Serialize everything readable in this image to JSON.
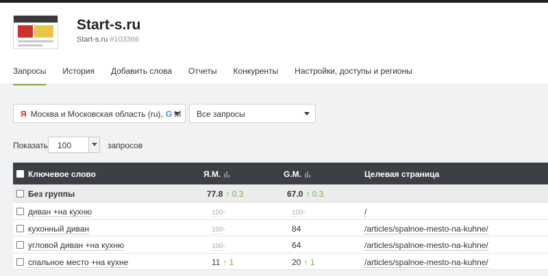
{
  "site": {
    "title": "Start-s.ru",
    "subtitle": "Start-s.ru",
    "id": "#103366"
  },
  "tabs": [
    {
      "label": "Запросы",
      "active": true
    },
    {
      "label": "История"
    },
    {
      "label": "Добавить слова"
    },
    {
      "label": "Отчеты"
    },
    {
      "label": "Конкуренты"
    },
    {
      "label": "Настройки, доступы и регионы"
    }
  ],
  "filters": {
    "region": {
      "ya_icon": "Я",
      "text": "Москва и Московская область (ru),",
      "g_icon": "G",
      "tail": "M"
    },
    "queries": {
      "text": "Все запросы"
    }
  },
  "pager": {
    "label": "Показать",
    "value": "100",
    "suffix": "запросов"
  },
  "table": {
    "headers": {
      "keyword": "Ключевое слово",
      "ya": "Я.М.",
      "google": "G.M.",
      "target": "Целевая страница"
    },
    "group": {
      "name": "Без группы",
      "ya": "77.8",
      "ya_delta": "↑ 0.3",
      "google": "67.0",
      "google_delta": "↑ 0.3"
    },
    "rows": [
      {
        "keyword": "диван +на кухню",
        "ya": "100-",
        "google": "100-",
        "target": "/"
      },
      {
        "keyword": "кухонный диван",
        "ya": "100-",
        "google": "84",
        "target": "/articles/spalnoe-mesto-na-kuhne/"
      },
      {
        "keyword": "угловой диван +на кухню",
        "ya": "100-",
        "google": "64",
        "target": "/articles/spalnoe-mesto-na-kuhne/"
      },
      {
        "keyword": "спальное место +на кухне",
        "ya": "11",
        "ya_delta": "↑ 1",
        "google": "20",
        "google_delta": "↑ 1",
        "target": "/articles/spalnoe-mesto-na-kuhne/"
      }
    ]
  },
  "colors": {
    "accent": "#7aa533",
    "header_bg": "#3c3f44",
    "up": "#6fb33e"
  },
  "icons": {
    "yandex": "yandex-icon",
    "google": "google-icon",
    "bars": "bar-chart-icon"
  }
}
